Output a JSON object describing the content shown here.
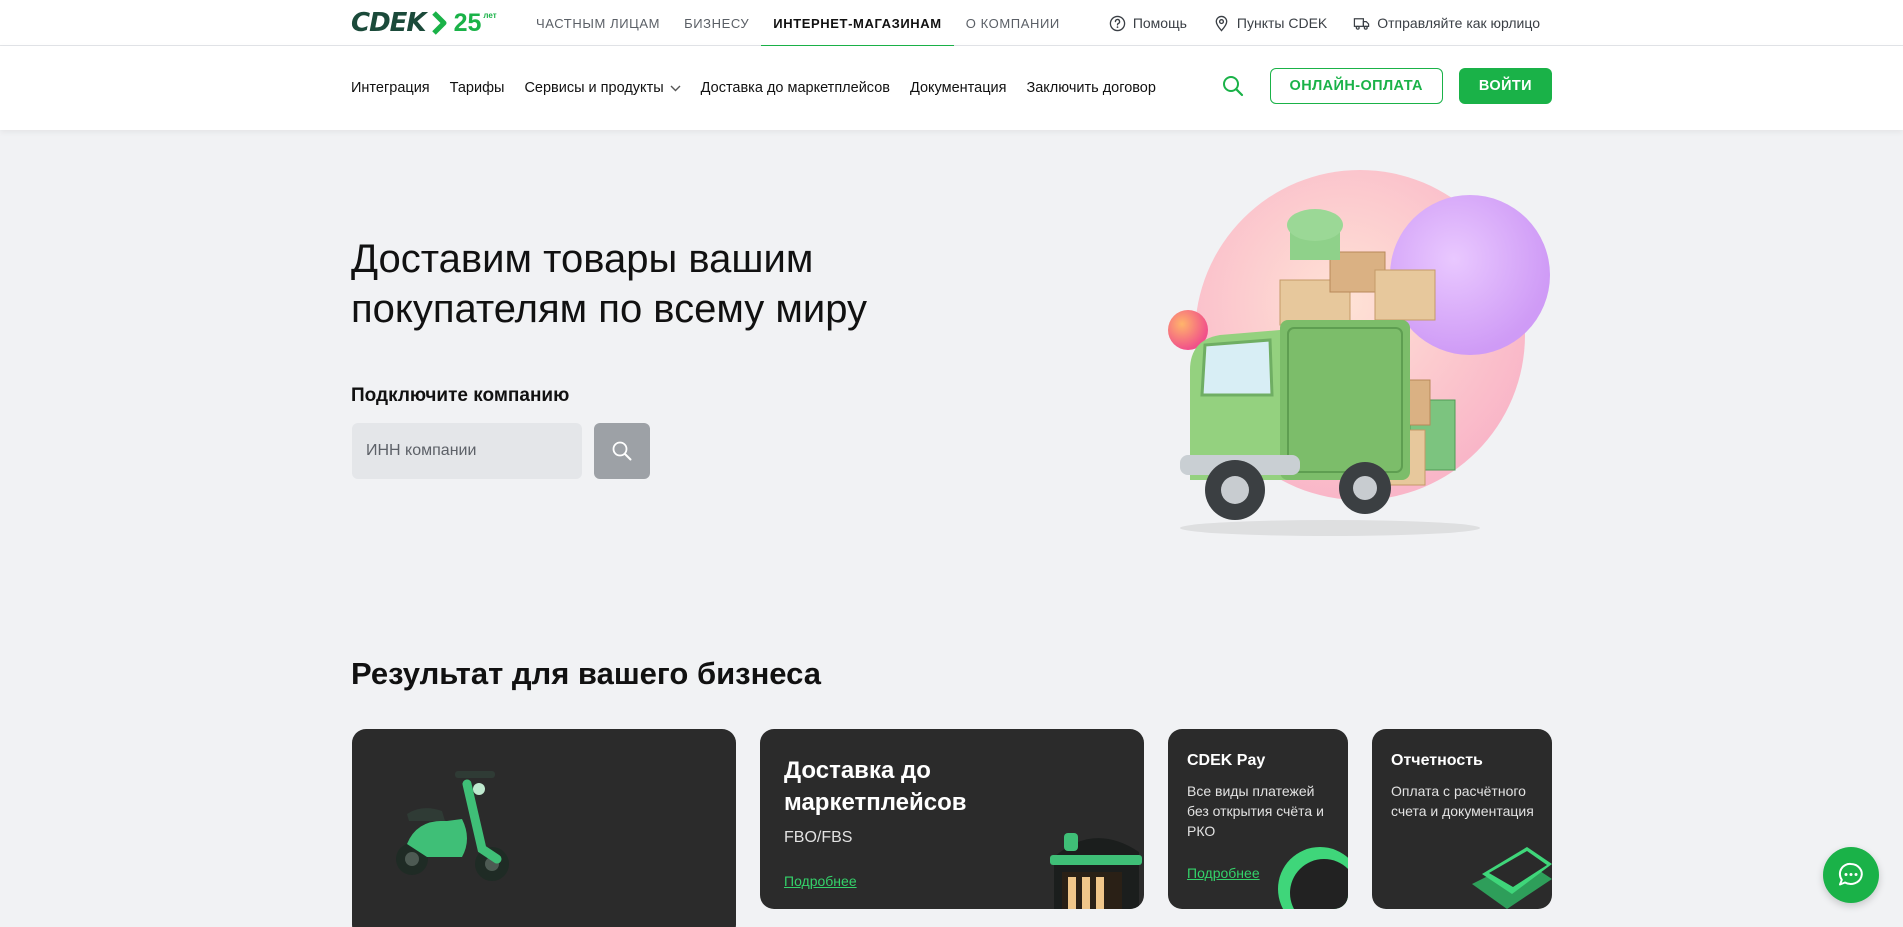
{
  "logo": {
    "brand": "CDEK",
    "years": "25",
    "years_unit": "лет"
  },
  "top_nav": [
    {
      "label": "ЧАСТНЫМ ЛИЦАМ",
      "active": false
    },
    {
      "label": "БИЗНЕСУ",
      "active": false
    },
    {
      "label": "ИНТЕРНЕТ-МАГАЗИНАМ",
      "active": true
    },
    {
      "label": "О КОМПАНИИ",
      "active": false
    }
  ],
  "top_util": {
    "help": {
      "label": "Помощь",
      "icon": "question-circle-icon"
    },
    "points": {
      "label": "Пункты CDEK",
      "icon": "location-pin-icon"
    },
    "legal": {
      "label": "Отправляйте как юрлицо",
      "icon": "truck-icon"
    }
  },
  "main_nav": {
    "integration": "Интеграция",
    "tariffs": "Тарифы",
    "services": "Сервисы и продукты",
    "marketplaces": "Доставка до маркетплейсов",
    "docs": "Документация",
    "contract": "Заключить договор"
  },
  "header": {
    "online_payment": "ОНЛАЙН-ОПЛАТА",
    "login": "ВОЙТИ"
  },
  "hero": {
    "title": "Доставим товары вашим покупателям по всему миру",
    "subtitle": "Подключите компанию",
    "inn_placeholder": "ИНН компании"
  },
  "section": {
    "title": "Результат для вашего бизнеса"
  },
  "cards": {
    "marketplaces": {
      "title": "Доставка до маркетплейсов",
      "subtitle": "FBO/FBS",
      "link": "Подробнее"
    },
    "pay": {
      "title": "CDEK Pay",
      "text": "Все виды платежей без открытия счёта и РКО",
      "link": "Подробнее"
    },
    "reporting": {
      "title": "Отчетность",
      "text": "Оплата с расчётного счета и документация"
    }
  },
  "colors": {
    "brand": "#1ab248",
    "brand_dark": "#1b4a3a",
    "card_bg": "#2b2b2b",
    "page_bg": "#f1f2f4"
  }
}
